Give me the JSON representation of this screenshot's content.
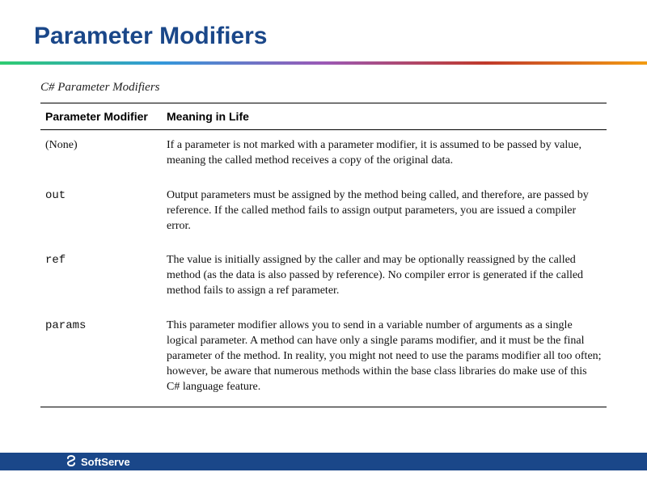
{
  "header": {
    "title": "Parameter Modifiers"
  },
  "table": {
    "caption": "C# Parameter Modifiers",
    "columns": {
      "modifier": "Parameter Modifier",
      "meaning": "Meaning in Life"
    },
    "rows": [
      {
        "modifier": "(None)",
        "modifier_code": false,
        "meaning": "If a parameter is not marked with a parameter modifier, it is assumed to be passed by value, meaning the called method receives a copy of the original data."
      },
      {
        "modifier": "out",
        "modifier_code": true,
        "meaning": "Output parameters must be assigned by the method being called, and therefore, are passed by reference. If the called method fails to assign output parameters, you are issued a compiler error."
      },
      {
        "modifier": "ref",
        "modifier_code": true,
        "meaning": "The value is initially assigned by the caller and may be optionally reassigned by the called method (as the data is also passed by reference). No compiler error is generated if the called method fails to assign a ref parameter."
      },
      {
        "modifier": "params",
        "modifier_code": true,
        "meaning": "This parameter modifier allows you to send in a variable number of arguments as a single logical parameter. A method can have only a single params modifier, and it must be the final parameter of the method. In reality, you might not need to use the params modifier all too often; however, be aware that numerous methods within the base class libraries do make use of this C# language feature."
      }
    ]
  },
  "footer": {
    "brand": "SoftServe"
  }
}
